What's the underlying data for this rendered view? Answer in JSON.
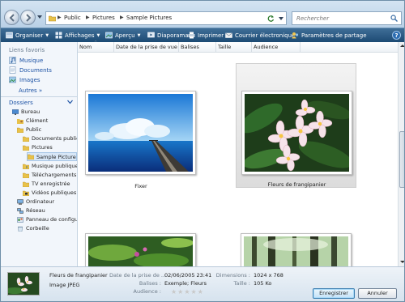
{
  "address": {
    "crumbs": [
      "Public",
      "Pictures",
      "Sample Pictures"
    ],
    "search_placeholder": "Rechercher"
  },
  "toolbar": {
    "organize": "Organiser",
    "views": "Affichages",
    "preview": "Aperçu",
    "slideshow": "Diaporama",
    "print": "Imprimer",
    "email": "Courrier électronique",
    "share": "Paramètres de partage"
  },
  "nav": {
    "favorites_title": "Liens favoris",
    "favorites": [
      "Musique",
      "Documents",
      "Images"
    ],
    "more": "Autres",
    "folders_title": "Dossiers",
    "tree": [
      "Bureau",
      "Clément",
      "Public",
      "Documents public",
      "Pictures",
      "Sample Pictures",
      "Musique publique",
      "Téléchargements",
      "TV enregistrée",
      "Vidéos publiques",
      "Ordinateur",
      "Réseau",
      "Panneau de configu",
      "Corbeille"
    ]
  },
  "columns": [
    "Nom",
    "Date de la prise de vue",
    "Balises",
    "Taille",
    "Audience"
  ],
  "files": [
    {
      "name": "Fixer"
    },
    {
      "name": "Fleurs de frangipanier"
    },
    {
      "name": ""
    },
    {
      "name": ""
    }
  ],
  "details": {
    "name": "Fleurs de frangipanier",
    "type": "Image JPEG",
    "date_label": "Date de la prise de ...",
    "date_value": "02/06/2005 23:41",
    "tags_label": "Balises :",
    "tags_value": "Exemple; Fleurs",
    "rating_label": "Audience :",
    "rating": 0,
    "dimensions_label": "Dimensions :",
    "dimensions_value": "1024 x 768",
    "size_label": "Taille :",
    "size_value": "105 Ko"
  },
  "buttons": {
    "save": "Enregistrer",
    "cancel": "Annuler"
  },
  "colors": {
    "toolbar": "#1d4b74",
    "link": "#1c52a4",
    "selected_item": "#d8e7f7"
  }
}
